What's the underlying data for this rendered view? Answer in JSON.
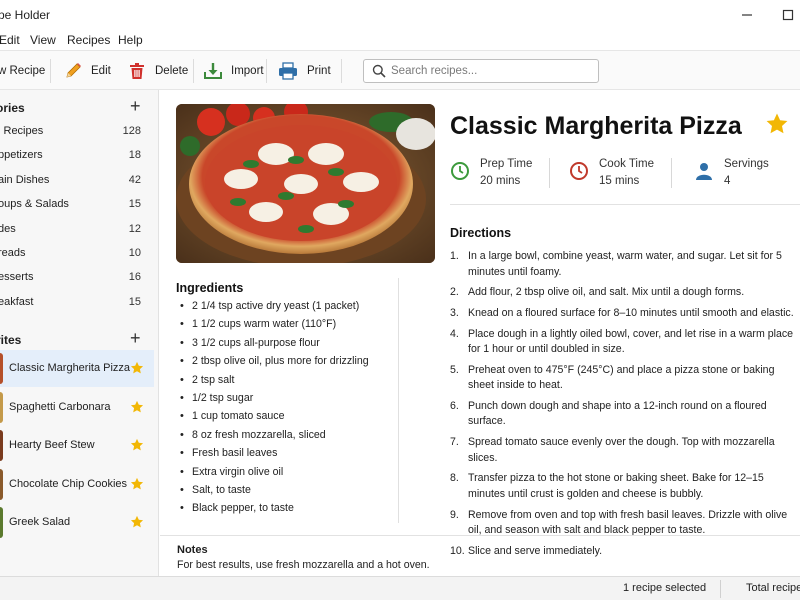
{
  "window": {
    "title": "pe Holder"
  },
  "menu": [
    "Edit",
    "View",
    "Recipes",
    "Help"
  ],
  "toolbar": {
    "new_label": "w Recipe",
    "edit_label": "Edit",
    "delete_label": "Delete",
    "import_label": "Import",
    "print_label": "Print",
    "search_placeholder": "Search recipes..."
  },
  "sidebar": {
    "categories_header": "ories",
    "categories": [
      {
        "name": "l Recipes",
        "count": "128"
      },
      {
        "name": "ppetizers",
        "count": "18"
      },
      {
        "name": "ain Dishes",
        "count": "42"
      },
      {
        "name": "oups & Salads",
        "count": "15"
      },
      {
        "name": "des",
        "count": "12"
      },
      {
        "name": "reads",
        "count": "10"
      },
      {
        "name": "esserts",
        "count": "16"
      },
      {
        "name": "eakfast",
        "count": "15"
      }
    ],
    "favorites_header": "rites",
    "favorites": [
      {
        "name": "Classic Margherita Pizza",
        "color": "#b5502a"
      },
      {
        "name": "Spaghetti Carbonara",
        "color": "#c49a4a"
      },
      {
        "name": "Hearty Beef Stew",
        "color": "#7a3b1e"
      },
      {
        "name": "Chocolate Chip Cookies",
        "color": "#8a5a2b"
      },
      {
        "name": "Greek Salad",
        "color": "#5b7a2e"
      }
    ]
  },
  "recipe": {
    "title": "Classic Margherita Pizza",
    "prep_label": "Prep Time",
    "prep_value": "20 mins",
    "cook_label": "Cook Time",
    "cook_value": "15 mins",
    "servings_label": "Servings",
    "servings_value": "4",
    "ingredients_title": "Ingredients",
    "ingredients": [
      "2 1/4 tsp active dry yeast (1 packet)",
      "1 1/2 cups warm water (110°F)",
      "3 1/2 cups all-purpose flour",
      "2 tbsp olive oil, plus more for drizzling",
      "2 tsp salt",
      "1/2 tsp sugar",
      "1 cup tomato sauce",
      "8 oz fresh mozzarella, sliced",
      "Fresh basil leaves",
      "Extra virgin olive oil",
      "Salt, to taste",
      "Black pepper, to taste"
    ],
    "directions_title": "Directions",
    "directions": [
      {
        "n": "1.",
        "text": "In a large bowl, combine yeast, warm water, and sugar. Let sit for 5 minutes until foamy."
      },
      {
        "n": "2.",
        "text": "Add flour, 2 tbsp olive oil, and salt. Mix until a dough forms."
      },
      {
        "n": "3.",
        "text": "Knead on a floured surface for 8–10 minutes until smooth and elastic."
      },
      {
        "n": "4.",
        "text": "Place dough in a lightly oiled bowl, cover, and let rise in a warm place for 1 hour or until doubled in size."
      },
      {
        "n": "5.",
        "text": "Preheat oven to 475°F (245°C) and place a pizza stone or baking sheet inside to heat."
      },
      {
        "n": "6.",
        "text": "Punch down dough and shape into a 12-inch round on a floured surface."
      },
      {
        "n": "7.",
        "text": "Spread tomato sauce evenly over the dough. Top with mozzarella slices."
      },
      {
        "n": "8.",
        "text": "Transfer pizza to the hot stone or baking sheet. Bake for 12–15 minutes until crust is golden and cheese is bubbly."
      },
      {
        "n": "9.",
        "text": "Remove from oven and top with fresh basil leaves. Drizzle with olive oil, and season with salt and black pepper to taste."
      },
      {
        "n": "10.",
        "text": "Slice and serve immediately."
      }
    ],
    "notes_title": "Notes",
    "notes_text": "For best results, use fresh mozzarella and a hot oven."
  },
  "status": {
    "selected": "1 recipe selected",
    "total": "Total recipes"
  },
  "colors": {
    "accent_star": "#f2b705",
    "selection": "#e4eefa",
    "prep_icon": "#3c9a3c",
    "cook_icon": "#c0392b",
    "servings_icon": "#2f6fa8"
  },
  "icons": {
    "new": "plus-icon",
    "edit": "pencil-icon",
    "delete": "trash-icon",
    "import": "import-icon",
    "print": "printer-icon",
    "search": "search-icon",
    "prep": "clock-icon",
    "cook": "clock-icon",
    "servings": "person-icon",
    "favorite": "star-icon"
  }
}
